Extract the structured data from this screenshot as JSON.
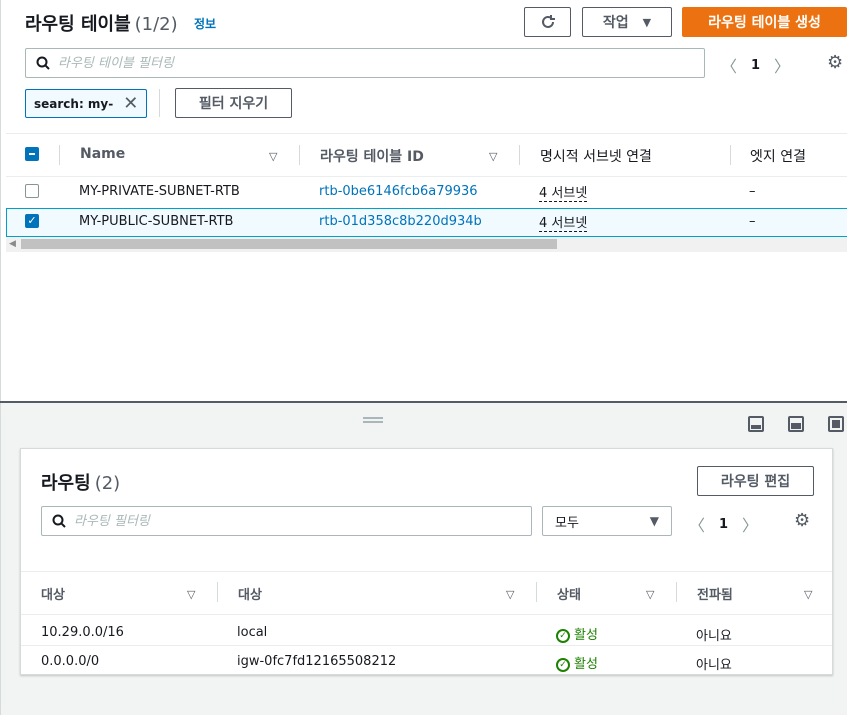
{
  "route_tables": {
    "title": "라우팅 테이블",
    "count": "(1/2)",
    "info_label": "정보",
    "refresh_icon": "refresh-icon",
    "actions_label": "작업",
    "create_label": "라우팅 테이블 생성",
    "search_placeholder": "라우팅 테이블 필터링",
    "page": "1",
    "filter_token": "search: my-",
    "clear_filters_label": "필터 지우기",
    "columns": [
      "Name",
      "라우팅 테이블 ID",
      "명시적 서브넷 연결",
      "엣지 연결"
    ],
    "rows": [
      {
        "name": "MY-PRIVATE-SUBNET-RTB",
        "id": "rtb-0be6146fcb6a79936",
        "subnets": "4 서브넷",
        "edge": "–",
        "selected": false
      },
      {
        "name": "MY-PUBLIC-SUBNET-RTB",
        "id": "rtb-01d358c8b220d934b",
        "subnets": "4 서브넷",
        "edge": "–",
        "selected": true
      }
    ]
  },
  "routes": {
    "title": "라우팅",
    "count": "(2)",
    "edit_label": "라우팅 편집",
    "search_placeholder": "라우팅 필터링",
    "select_value": "모두",
    "page": "1",
    "columns": [
      "대상",
      "대상",
      "상태",
      "전파됨"
    ],
    "rows": [
      {
        "destination": "10.29.0.0/16",
        "target": "local",
        "status": "활성",
        "propagated": "아니요",
        "target_link": false
      },
      {
        "destination": "0.0.0.0/0",
        "target": "igw-0fc7fd12165508212",
        "status": "활성",
        "propagated": "아니요",
        "target_link": true
      }
    ]
  },
  "colors": {
    "accent": "#ec7211",
    "link": "#0073bb",
    "success": "#1d8102"
  }
}
